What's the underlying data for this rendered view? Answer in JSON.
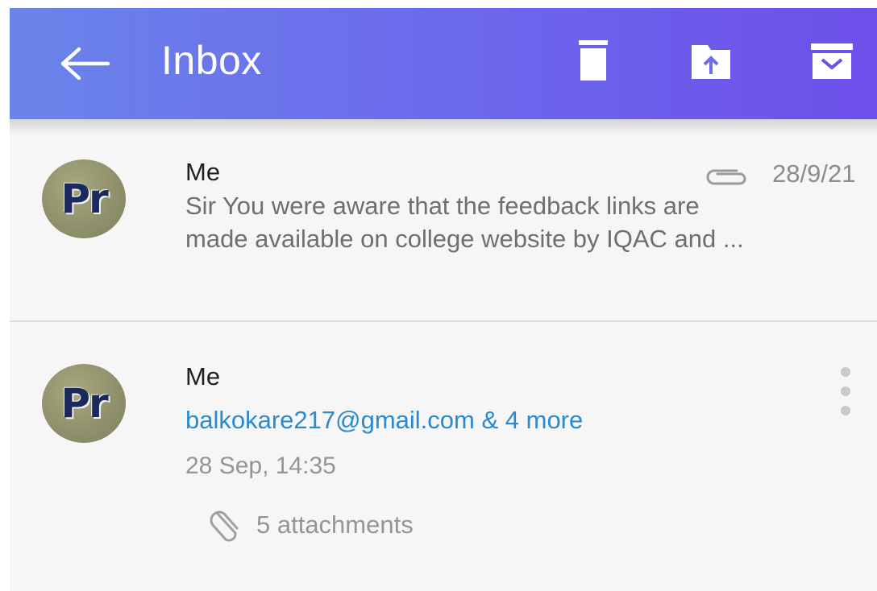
{
  "header": {
    "title": "Inbox",
    "back_icon": "arrow-left-icon",
    "actions": [
      "trash-icon",
      "move-to-folder-icon",
      "archive-icon"
    ],
    "gradient": [
      "#6a84ea",
      "#6d4fea"
    ]
  },
  "messages": [
    {
      "avatar_text": "Pr",
      "sender": "Me",
      "has_attachment": true,
      "date": "28/9/21",
      "preview_line1": "Sir You were aware that the feedback links are",
      "preview_line2": "made available on college website by IQAC and ..."
    },
    {
      "avatar_text": "Pr",
      "sender": "Me",
      "recipients": "balkokare217@gmail.com & 4 more",
      "timestamp": "28 Sep, 14:35",
      "attachments": "5 attachments",
      "menu_icon": "more-vertical-icon"
    }
  ],
  "colors": {
    "link": "#2a8ad1",
    "muted": "#959595",
    "list_bg": "#f6f6f6"
  }
}
